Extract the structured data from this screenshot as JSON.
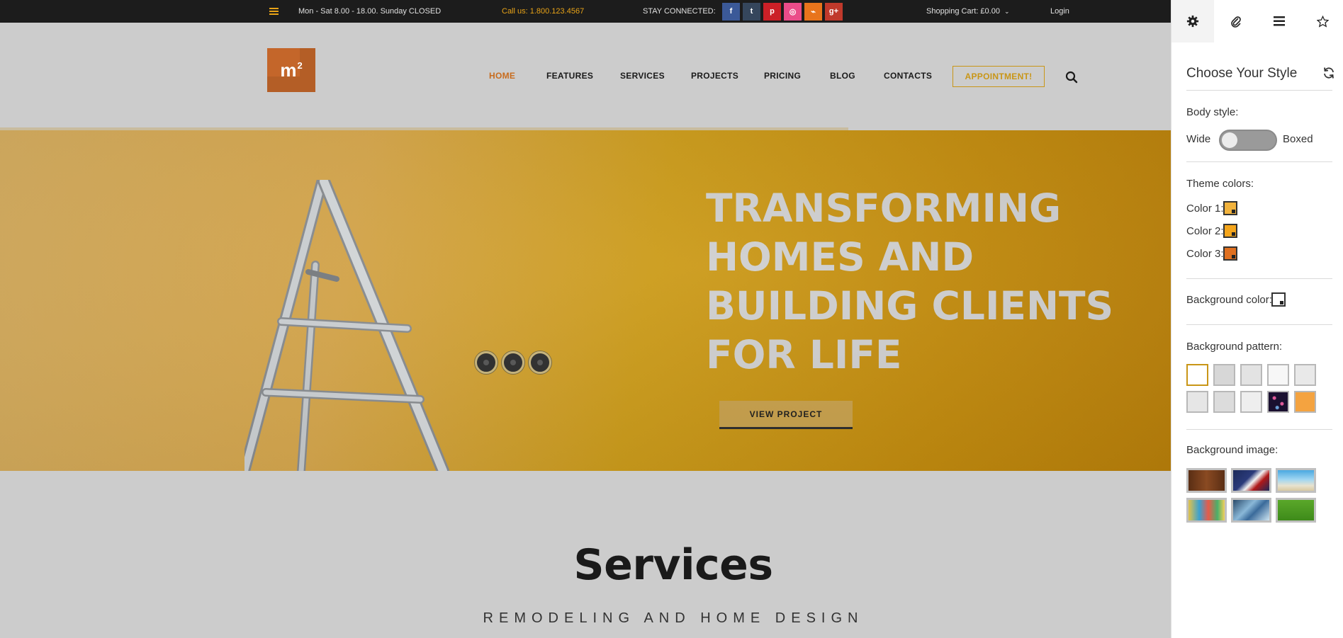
{
  "topbar": {
    "hours": "Mon - Sat 8.00 - 18.00. Sunday CLOSED",
    "call": "Call us: 1.800.123.4567",
    "stay_connected": "STAY CONNECTED:",
    "socials": [
      {
        "icon": "facebook-icon",
        "glyph": "f",
        "color": "#3b5998"
      },
      {
        "icon": "tumblr-icon",
        "glyph": "t",
        "color": "#35465c"
      },
      {
        "icon": "pinterest-icon",
        "glyph": "p",
        "color": "#cb2027"
      },
      {
        "icon": "dribbble-icon",
        "glyph": "◎",
        "color": "#ea4c89"
      },
      {
        "icon": "rss-icon",
        "glyph": "⌁",
        "color": "#e8741c"
      },
      {
        "icon": "google-plus-icon",
        "glyph": "g+",
        "color": "#c0392b"
      }
    ],
    "cart": "Shopping Cart: £0.00",
    "login": "Login"
  },
  "header": {
    "logo_text": "m",
    "logo_sup": "2",
    "nav": [
      "HOME",
      "FEATURES",
      "SERVICES",
      "PROJECTS",
      "PRICING",
      "BLOG",
      "CONTACTS"
    ],
    "active_nav": "HOME",
    "appointment": "APPOINTMENT!"
  },
  "hero": {
    "title_lines": [
      "TRANSFORMING",
      "HOMES AND",
      "BUILDING CLIENTS",
      "FOR LIFE"
    ],
    "button": "VIEW PROJECT"
  },
  "services": {
    "title": "Services",
    "subtitle": "REMODELING AND HOME DESIGN"
  },
  "panel": {
    "tabs": [
      "gear-icon",
      "paperclip-icon",
      "list-icon",
      "star-icon"
    ],
    "title": "Choose Your Style",
    "body_style_label": "Body style:",
    "wide": "Wide",
    "boxed": "Boxed",
    "theme_colors_label": "Theme colors:",
    "colors": [
      {
        "label": "Color 1:",
        "value": "#f2b33d"
      },
      {
        "label": "Color 2:",
        "value": "#f5a51b"
      },
      {
        "label": "Color 3:",
        "value": "#e07020"
      }
    ],
    "background_color_label": "Background color:",
    "background_color_value": "#ffffff",
    "background_pattern_label": "Background pattern:",
    "patterns": [
      "#ffffff",
      "#d7d7d7",
      "#e3e3e3",
      "#f7f7f7",
      "#e9e9e9",
      "#e6e6e6",
      "#dcdcdc",
      "#eeeeee",
      "#1a1030",
      "#f4a340"
    ],
    "background_image_label": "Background image:",
    "images": [
      "wood",
      "eagle",
      "beach",
      "street",
      "glass",
      "grass"
    ]
  }
}
